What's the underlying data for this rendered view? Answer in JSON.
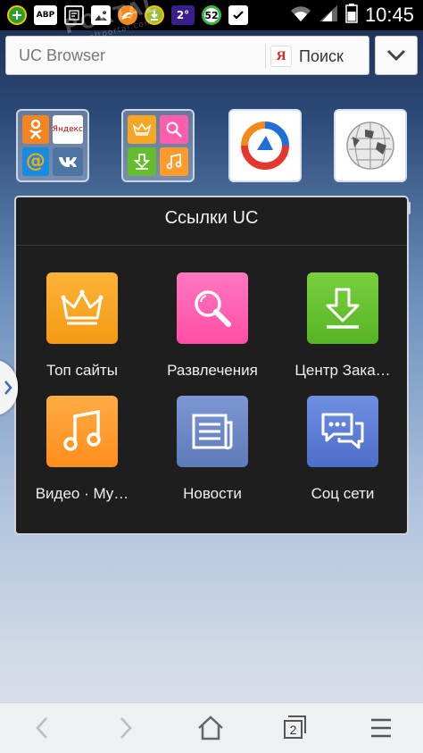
{
  "status_bar": {
    "time": "10:45",
    "notifications": [
      {
        "icon": "green-plus-icon",
        "label": ""
      },
      {
        "icon": "adblock-icon",
        "label": "ABP"
      },
      {
        "icon": "screenshot-icon",
        "label": ""
      },
      {
        "icon": "gallery-icon",
        "label": ""
      },
      {
        "icon": "uc-browser-icon",
        "label": ""
      },
      {
        "icon": "download-manager-icon",
        "label": ""
      },
      {
        "icon": "temperature-icon",
        "label": "2°"
      },
      {
        "icon": "battery-percent-icon",
        "label": "52"
      },
      {
        "icon": "clipboard-check-icon",
        "label": ""
      }
    ]
  },
  "watermark": {
    "main": "PORTAL",
    "sub": "www.softportal.com"
  },
  "address_bar": {
    "value": "UC Browser",
    "search_engine_logo": "Я",
    "search_label": "Поиск"
  },
  "top_tiles": {
    "folder1": [
      {
        "icon": "odnoklassniki-icon",
        "text": "",
        "color": "#f48420"
      },
      {
        "icon": "yandex-icon",
        "text": "Яндекс",
        "color": "#ffffff"
      },
      {
        "icon": "mail-ru-icon",
        "text": "@",
        "color": "#168de2"
      },
      {
        "icon": "vk-icon",
        "text": "",
        "color": "#4c75a3"
      }
    ],
    "folder2": [
      {
        "icon": "crown-icon",
        "color": "#f7a623"
      },
      {
        "icon": "magnifier-icon",
        "color": "#ff5dae"
      },
      {
        "icon": "download-icon",
        "color": "#64bd2c"
      },
      {
        "icon": "music-icon",
        "color": "#ff9a2b"
      }
    ],
    "single1": {
      "icon": "circular-arrows-logo-icon"
    },
    "single2": {
      "icon": "wikipedia-globe-icon"
    }
  },
  "popup": {
    "title": "Ссылки UC",
    "items": [
      {
        "label": "Топ сайты",
        "icon": "crown-icon",
        "color": "#f9a31f"
      },
      {
        "label": "Развлечения",
        "icon": "magnifier-icon",
        "color": "#ff5eb0"
      },
      {
        "label": "Центр Зака…",
        "icon": "download-icon",
        "color": "#66c42f"
      },
      {
        "label": "Видео · Му…",
        "icon": "music-note-icon",
        "color": "#ff9a2b"
      },
      {
        "label": "Новости",
        "icon": "newspaper-icon",
        "color": "#6c88c6"
      },
      {
        "label": "Соц сети",
        "icon": "chat-bubbles-icon",
        "color": "#5b7fd6"
      }
    ]
  },
  "bottom_nav": {
    "tabs_count": "2",
    "buttons": [
      "back-icon",
      "forward-icon",
      "home-icon",
      "tabs-icon",
      "menu-icon"
    ]
  }
}
